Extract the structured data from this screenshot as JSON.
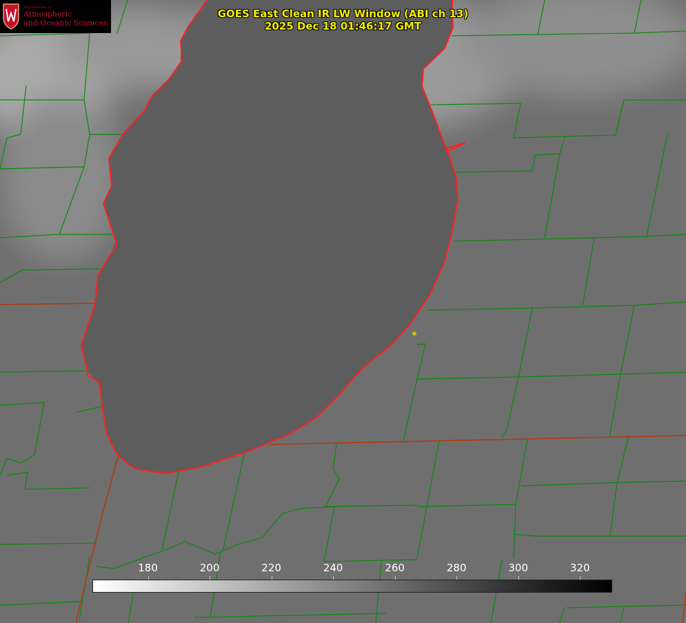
{
  "title": {
    "line1": "GOES East Clean IR LW Window (ABI ch 13)",
    "line2": "2025 Dec 18 01:46:17 GMT"
  },
  "logo": {
    "department": "Department of",
    "line1": "Atmospheric",
    "line2": "and Oceanic Sciences"
  },
  "colorbar": {
    "ticks": [
      "180",
      "200",
      "220",
      "240",
      "260",
      "280",
      "300",
      "320"
    ],
    "range": [
      162,
      330
    ],
    "gradient": [
      "#ffffff",
      "#000000"
    ]
  },
  "colors": {
    "county_lines": "#0a8a0a",
    "state_lines": "#b03a10",
    "shoreline": "#ff2020",
    "marker": "#c8c000",
    "title": "#f4f000"
  }
}
